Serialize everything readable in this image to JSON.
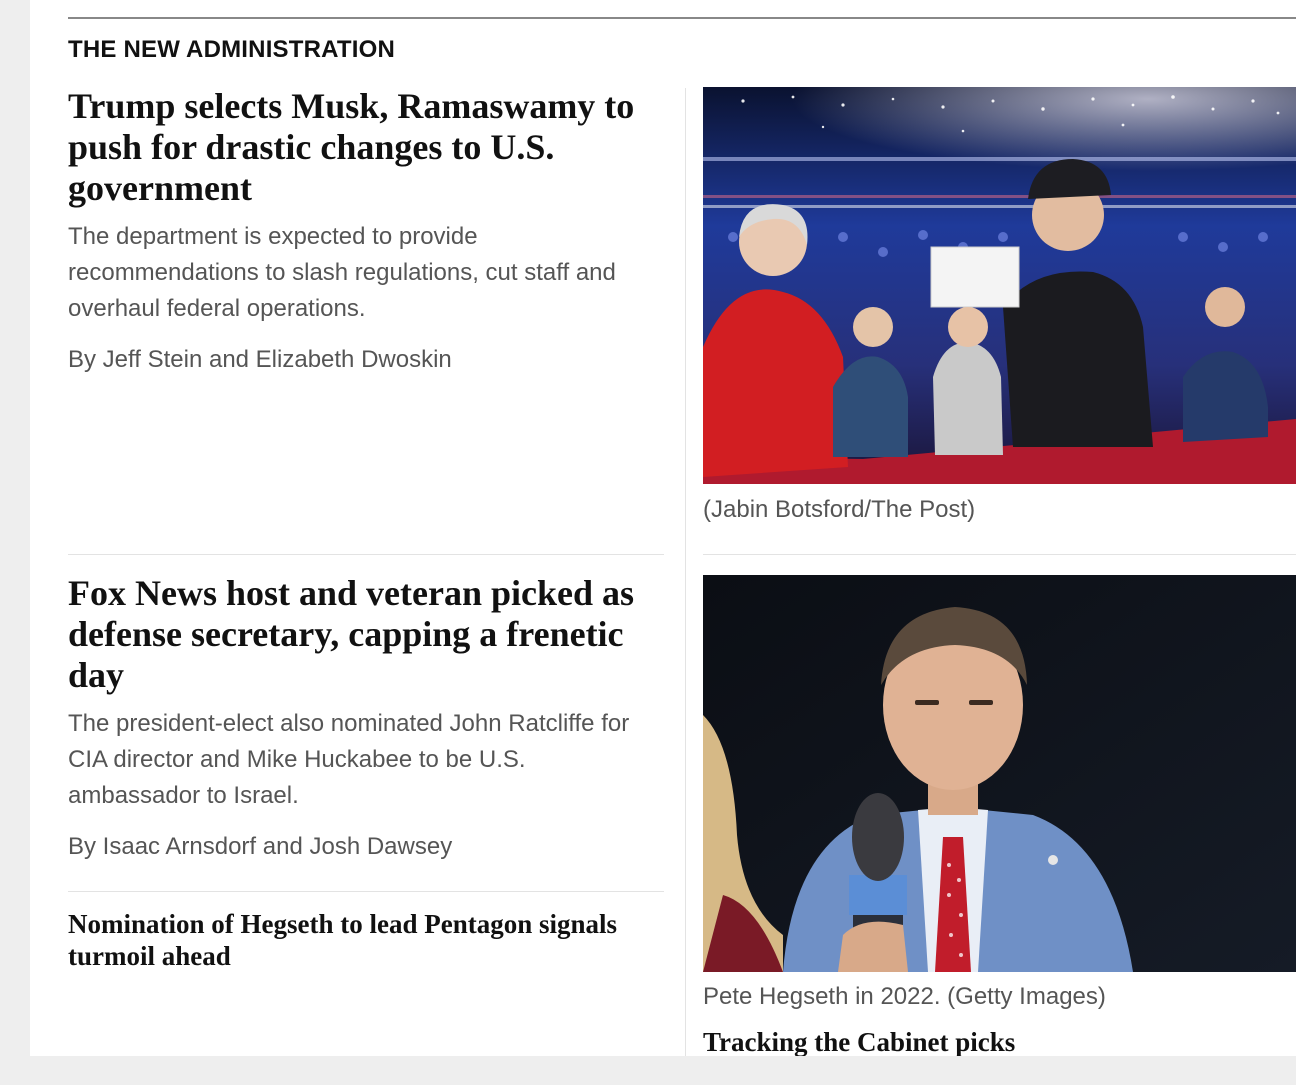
{
  "section": {
    "label": "THE NEW ADMINISTRATION"
  },
  "stories": [
    {
      "headline": "Trump selects Musk, Ramaswamy to push for drastic changes to U.S. government",
      "dek": "The department is expected to provide recommendations to slash regulations, cut staff and overhaul federal operations.",
      "byline": "By Jeff Stein and Elizabeth Dwoskin",
      "photo_caption": "(Jabin Botsford/The Post)"
    },
    {
      "headline": "Fox News host and veteran picked as defense secretary, capping a frenetic day",
      "dek": "The president-elect also nominated John Ratcliffe for CIA director and Mike Huckabee to be U.S. ambassador to Israel.",
      "byline": "By Isaac Arnsdorf and Josh Dawsey",
      "photo_caption": "Pete Hegseth  in 2022. (Getty Images)"
    }
  ],
  "related_links": [
    "Nomination of Hegseth to lead Pentagon signals turmoil ahead",
    "Tracking the Cabinet picks"
  ],
  "colors": {
    "text_primary": "#111111",
    "text_secondary": "#555555",
    "rule": "#e3e3e3",
    "page_bg": "#ffffff",
    "outer_bg": "#eeeeee"
  }
}
